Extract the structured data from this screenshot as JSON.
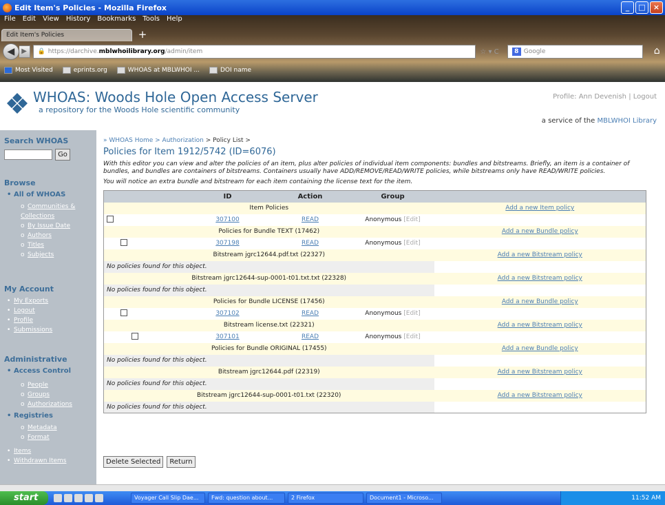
{
  "window": {
    "title": "Edit Item's Policies - Mozilla Firefox"
  },
  "menu": [
    "File",
    "Edit",
    "View",
    "History",
    "Bookmarks",
    "Tools",
    "Help"
  ],
  "tab": {
    "label": "Edit Item's Policies"
  },
  "address": {
    "prefix": "https://darchive.",
    "domain": "mblwhoilibrary.org",
    "path": "/admin/item"
  },
  "search": {
    "placeholder": "Google"
  },
  "bookmarks": [
    "Most Visited",
    "eprints.org",
    "WHOAS at MBLWHOI ...",
    "DOI name"
  ],
  "header": {
    "title": "WHOAS: Woods Hole Open Access Server",
    "tagline": "a repository for the Woods Hole scientific community",
    "profile": "Profile: Ann Devenish",
    "logout": "Logout",
    "service_prefix": "a service of the ",
    "service_link": "MBLWHOI Library"
  },
  "sidebar": {
    "search_heading": "Search WHOAS",
    "go": "Go",
    "browse_heading": "Browse",
    "all_of": "All of WHOAS",
    "browse_items": [
      "Communities & Collections",
      "By Issue Date",
      "Authors",
      "Titles",
      "Subjects"
    ],
    "account_heading": "My Account",
    "account_items": [
      "My Exports",
      "Logout",
      "Profile",
      "Submissions"
    ],
    "admin_heading": "Administrative",
    "access_control": "Access Control",
    "access_items": [
      "People",
      "Groups",
      "Authorizations"
    ],
    "registries": "Registries",
    "registry_items": [
      "Metadata",
      "Format"
    ],
    "more_items": [
      "Items",
      "Withdrawn Items"
    ]
  },
  "main": {
    "breadcrumb": {
      "home": "» WHOAS Home",
      "sep": " > ",
      "auth": "Authorization",
      "current": " > Policy List >"
    },
    "title": "Policies for Item 1912/5742 (ID=6076)",
    "desc1": "With this editor you can view and alter the policies of an item, plus alter policies of individual item components: bundles and bitstreams. Briefly, an item is a container of bundles, and bundles are containers of bitstreams. Containers usually have ADD/REMOVE/READ/WRITE policies, while bitstreams only have READ/WRITE policies.",
    "desc2": "You will notice an extra bundle and bitstream for each item containing the license text for the item.",
    "table_headers": [
      "ID",
      "Action",
      "Group"
    ],
    "item_policies": "Item Policies",
    "add_item": "Add a new Item policy",
    "add_bundle": "Add a new Bundle policy",
    "add_bitstream": "Add a new Bitstream policy",
    "no_policies": "No policies found for this object.",
    "anonymous": "Anonymous",
    "edit": "[Edit]",
    "read": "READ",
    "ids": [
      "307100",
      "307198",
      "307102",
      "307101"
    ],
    "bundles": [
      "Policies for Bundle TEXT (17462)",
      "Policies for Bundle LICENSE (17456)",
      "Policies for Bundle ORIGINAL (17455)"
    ],
    "bitstreams": [
      "Bitstream jgrc12644.pdf.txt (22327)",
      "Bitstream jgrc12644-sup-0001-t01.txt.txt (22328)",
      "Bitstream license.txt (22321)",
      "Bitstream jgrc12644.pdf (22319)",
      "Bitstream jgrc12644-sup-0001-t01.txt (22320)"
    ],
    "delete_btn": "Delete Selected",
    "return_btn": "Return"
  },
  "taskbar": {
    "start": "start",
    "tasks": [
      "Voyager Call Slip Dae...",
      "Fwd: question about...",
      "2 Firefox",
      "Document1 - Microso..."
    ],
    "clock": "11:52 AM"
  }
}
